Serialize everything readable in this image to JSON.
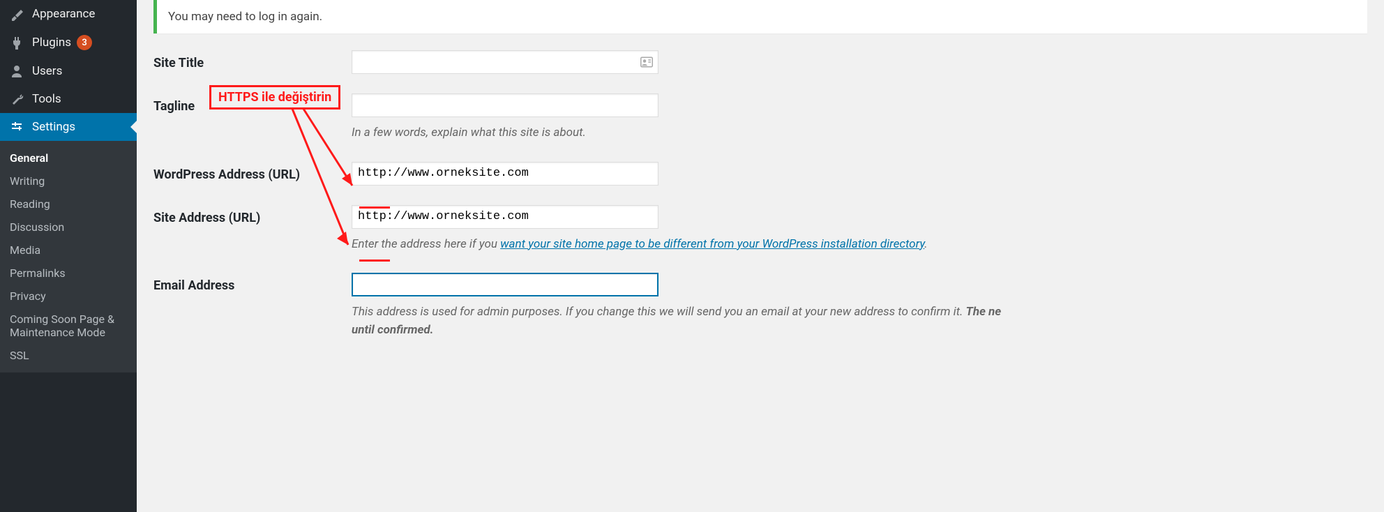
{
  "sidebar": {
    "items": [
      {
        "label": "Appearance",
        "icon": "brush"
      },
      {
        "label": "Plugins",
        "icon": "plug",
        "badge": "3"
      },
      {
        "label": "Users",
        "icon": "user"
      },
      {
        "label": "Tools",
        "icon": "wrench"
      },
      {
        "label": "Settings",
        "icon": "sliders",
        "active": true
      }
    ],
    "submenu": [
      {
        "label": "General",
        "current": true
      },
      {
        "label": "Writing"
      },
      {
        "label": "Reading"
      },
      {
        "label": "Discussion"
      },
      {
        "label": "Media"
      },
      {
        "label": "Permalinks"
      },
      {
        "label": "Privacy"
      },
      {
        "label": "Coming Soon Page & Maintenance Mode"
      },
      {
        "label": "SSL"
      }
    ]
  },
  "notice": {
    "text": "You may need to log in again."
  },
  "form": {
    "site_title": {
      "label": "Site Title",
      "value": ""
    },
    "tagline": {
      "label": "Tagline",
      "value": "",
      "description": "In a few words, explain what this site is about."
    },
    "wp_url": {
      "label": "WordPress Address (URL)",
      "value": "http://www.orneksite.com"
    },
    "site_url": {
      "label": "Site Address (URL)",
      "value": "http://www.orneksite.com",
      "description_pre": "Enter the address here if you ",
      "description_link": "want your site home page to be different from your WordPress installation directory",
      "description_post": "."
    },
    "email": {
      "label": "Email Address",
      "value": "",
      "description_pre": "This address is used for admin purposes. If you change this we will send you an email at your new address to confirm it. ",
      "description_bold": "The ne",
      "description_line2": "until confirmed."
    }
  },
  "annotation": {
    "label": "HTTPS ile değiştirin"
  }
}
